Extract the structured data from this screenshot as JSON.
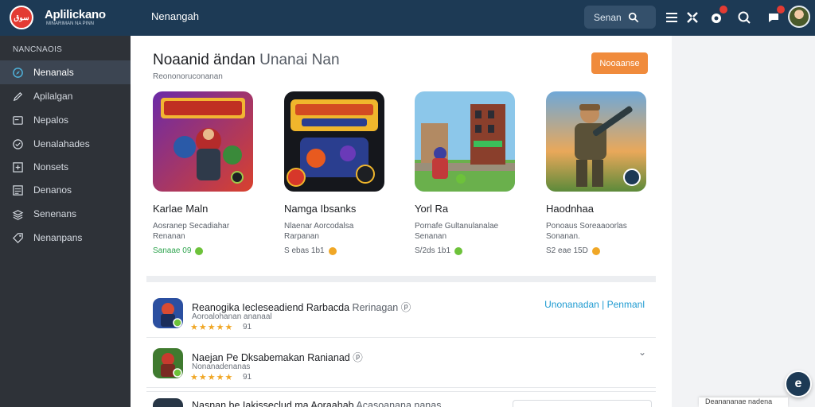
{
  "header": {
    "logo_text": "سوق",
    "brand": "Aplilickano",
    "brand_sub": "MINARIMAN NA PINN",
    "nav_link": "Nenangah",
    "search_label": "Senan"
  },
  "sidebar": {
    "heading": "NANCNAOIS",
    "items": [
      {
        "label": "Nenanals",
        "icon": "compass-icon"
      },
      {
        "label": "Apilalgan",
        "icon": "pen-icon"
      },
      {
        "label": "Nepalos",
        "icon": "card-icon"
      },
      {
        "label": "Uenalahades",
        "icon": "circle-check-icon"
      },
      {
        "label": "Nonsets",
        "icon": "plus-square-icon"
      },
      {
        "label": "Denanos",
        "icon": "list-icon"
      },
      {
        "label": "Senenans",
        "icon": "stack-icon"
      },
      {
        "label": "Nenanpans",
        "icon": "tag-icon"
      }
    ]
  },
  "main": {
    "title_bold": "Noaanid ändan",
    "title_light": "Unanai Nan",
    "subtitle": "Reononoruconanan",
    "cta_label": "Nooaanse",
    "cards": [
      {
        "title": "Karlae Maln",
        "desc_line1": "Aosranep Secadiahar",
        "desc_line2": "Renanan",
        "meta": "Sanaae 09",
        "meta_color": "#2fa44f",
        "dot_color": "#6dc23a"
      },
      {
        "title": "Namga Ibsanks",
        "desc_line1": "Nlaenar Aorcodalsa",
        "desc_line2": "Rarpanan",
        "meta": "S ebas 1b1",
        "meta_color": "#5a6069",
        "dot_color": "#f0a726"
      },
      {
        "title": "Yorl Ra",
        "desc_line1": "Pornafe Gultanulanalae",
        "desc_line2": "Senanan",
        "meta": "S/2ds 1b1",
        "meta_color": "#5a6069",
        "dot_color": "#6dc23a"
      },
      {
        "title": "Haodnhaa",
        "desc_line1": "Ponoaus Soreaaoorlas",
        "desc_line2": "Sonanan.",
        "meta": "S2 eae 15D",
        "meta_color": "#5a6069",
        "dot_color": "#f0a726"
      }
    ],
    "list": [
      {
        "title": "Reanogika Iecleseadiend Rarbacda",
        "title_muted": "Rerinagan ⓟ",
        "sub": "Aoroalohanan ananaal",
        "stars": "★★★★★",
        "count": "91",
        "action": "Unonanadan | Penmanl"
      },
      {
        "title": "Naejan Pe Dksabemakan Ranianad",
        "title_muted": "ⓟ",
        "sub": "Nonanadenanas",
        "stars": "★★★★★",
        "count": "91",
        "action": "⌄"
      }
    ],
    "partial_row": {
      "title": "Nasnan be Iakisseclud ma Aoraahab",
      "title_muted": "Acasoanana nanas"
    }
  },
  "floating": {
    "help_label": "e",
    "toast_text": "Deanananae nadena"
  },
  "colors": {
    "topbar": "#1d3a55",
    "sidebar": "#2e3238",
    "accent_orange": "#f08b3c",
    "link_blue": "#1f9bd1",
    "star": "#f0a726"
  }
}
